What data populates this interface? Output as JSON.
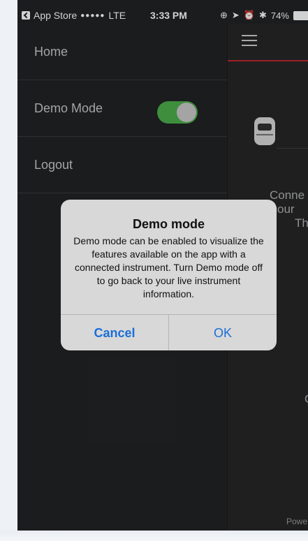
{
  "status_bar": {
    "back_app": "App Store",
    "signal": "●●●●●",
    "network": "LTE",
    "time": "3:33 PM",
    "battery": "74%",
    "icons": [
      "screen-lock-icon",
      "location-icon",
      "alarm-icon",
      "bluetooth-icon",
      "battery-icon"
    ]
  },
  "menu": {
    "items": [
      {
        "label": "Home"
      },
      {
        "label": "Demo Mode",
        "toggle_on": true
      },
      {
        "label": "Logout"
      }
    ]
  },
  "content_peek": {
    "line1": "Conne",
    "line2": "ccour",
    "line3": "Th",
    "line4": "C",
    "footer": "Powe",
    "accent_color": "#c0282d"
  },
  "alert": {
    "title": "Demo mode",
    "message": "Demo mode can be enabled to visualize the features available on the app with a connected instrument. Turn Demo mode off to go back to your live instrument information.",
    "cancel_label": "Cancel",
    "ok_label": "OK",
    "button_color": "#1a6fd9"
  }
}
